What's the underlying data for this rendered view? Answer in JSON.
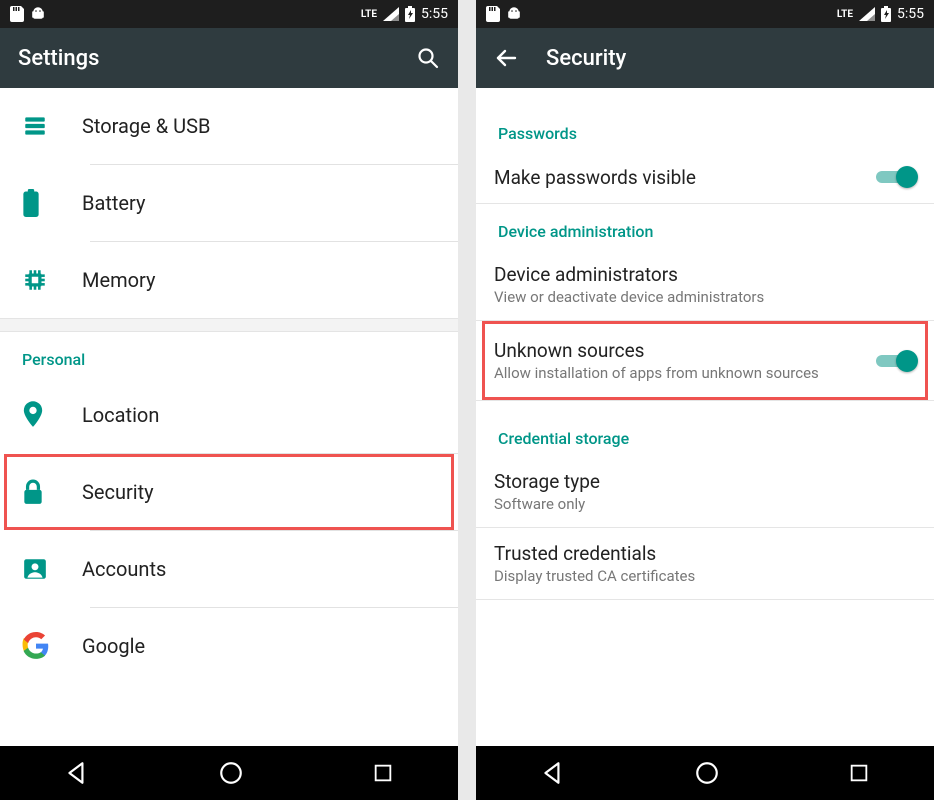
{
  "status": {
    "lte": "LTE",
    "time": "5:55"
  },
  "left": {
    "title": "Settings",
    "items": {
      "storage": "Storage & USB",
      "battery": "Battery",
      "memory": "Memory"
    },
    "section_personal": "Personal",
    "personal": {
      "location": "Location",
      "security": "Security",
      "accounts": "Accounts",
      "google": "Google"
    }
  },
  "right": {
    "title": "Security",
    "section_passwords": "Passwords",
    "make_pw_visible": "Make passwords visible",
    "section_device_admin": "Device administration",
    "device_admins_title": "Device administrators",
    "device_admins_sub": "View or deactivate device administrators",
    "unknown_title": "Unknown sources",
    "unknown_sub": "Allow installation of apps from unknown sources",
    "section_cred": "Credential storage",
    "storage_type_title": "Storage type",
    "storage_type_sub": "Software only",
    "trusted_title": "Trusted credentials",
    "trusted_sub": "Display trusted CA certificates"
  }
}
